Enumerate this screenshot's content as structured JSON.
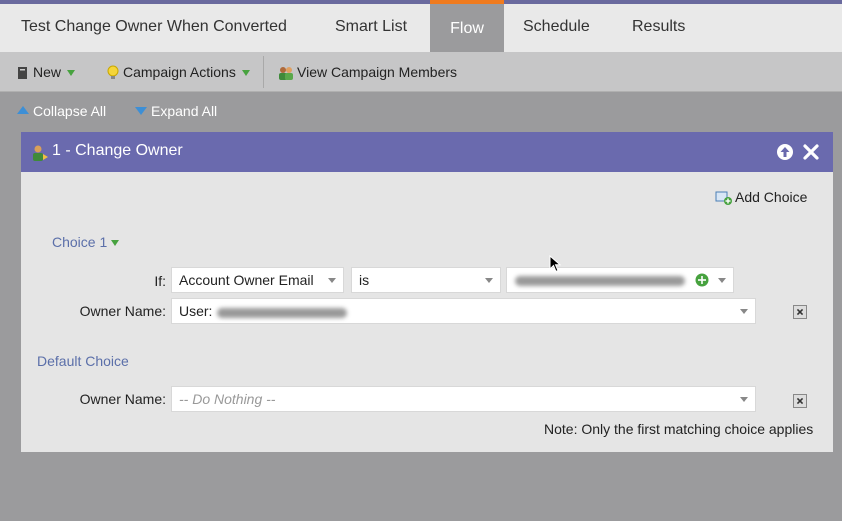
{
  "tabs": {
    "title": "Test Change Owner When Converted",
    "smart_list": "Smart List",
    "flow": "Flow",
    "schedule": "Schedule",
    "results": "Results"
  },
  "toolbar": {
    "new_label": "New",
    "campaign_actions_label": "Campaign Actions",
    "view_members_label": "View Campaign Members"
  },
  "collapse": {
    "collapse_all": "Collapse All",
    "expand_all": "Expand All"
  },
  "step": {
    "title": "1 - Change Owner",
    "add_choice": "Add Choice",
    "choice_label": "Choice 1",
    "if_label": "If:",
    "field_value": "Account Owner Email",
    "operator_value": "is",
    "owner_name_label": "Owner Name:",
    "owner_value": "User:",
    "default_choice_label": "Default Choice",
    "default_owner_label": "Owner Name:",
    "default_owner_placeholder": "-- Do Nothing --",
    "note": "Note: Only the first matching choice applies"
  },
  "colors": {
    "accent_orange": "#f07b1e",
    "panel_header": "#6a6aae",
    "link_blue": "#5b6fa9"
  }
}
